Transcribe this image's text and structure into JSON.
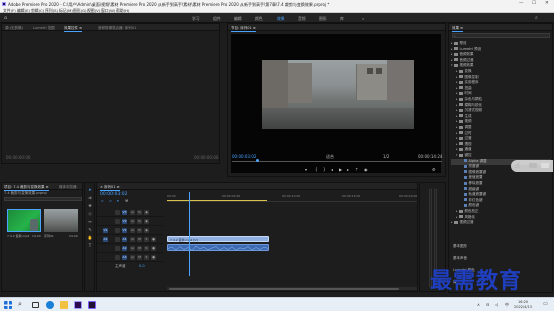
{
  "window": {
    "title": "Adobe Premiere Pro 2020 - C:\\用户\\Admin\\桌面\\视频\\素材 Premiere Pro 2020 从新手到高手\\素材\\素材 Premiere Pro 2020 从新手到高手\\第7章\\7.4 裁剪与变换效果.prproj *",
    "minimize": "—",
    "maximize": "☐",
    "close": "✕"
  },
  "menu": [
    "文件(F)",
    "编辑(E)",
    "剪辑(C)",
    "序列(S)",
    "标记(M)",
    "图形(G)",
    "视图(V)",
    "窗口(W)",
    "帮助(H)"
  ],
  "workspaces": [
    "学习",
    "组件",
    "编辑",
    "颜色",
    "效果",
    "音频",
    "图形",
    "库"
  ],
  "active_workspace": "效果",
  "source_panel": {
    "tabs": [
      "源:(无剪辑)",
      "Lumetri 范围",
      "效果控件 ≡",
      "音频剪辑混合器: 序列01"
    ],
    "active_tab": "效果控件 ≡",
    "timecode_left": "00:00:00:00",
    "timecode_right": "00:00:00:00"
  },
  "program_panel": {
    "title": "节目: 序列01 ≡",
    "timecode": "00:00:03:02",
    "fit": "适合",
    "quality": "1/2",
    "duration": "00:00:14:24"
  },
  "project_panel": {
    "tabs": [
      "项目: 7.4 裁剪与变换效果 ≡",
      "媒体浏览器"
    ],
    "path": "7.4 裁剪与变换效果.prproj",
    "items": [
      {
        "name": "7.4.2 变换.mp4",
        "duration": "14:24"
      },
      {
        "name": "序列01",
        "duration": "14:24"
      }
    ]
  },
  "timeline": {
    "title": "× 序列01 ≡",
    "timecode": "00:00:03:02",
    "ruler": [
      "00:00",
      "00:00:05:00",
      "00:00:10:00",
      "00:00:15:00",
      "00:00:20:00"
    ],
    "video_tracks": [
      "V3",
      "V2",
      "V1"
    ],
    "audio_tracks": [
      "A1",
      "A2",
      "A3"
    ],
    "master": "主声道",
    "master_value": "0.0",
    "clip_label": "7.4.2 变换.mp4 [V]",
    "playhead_fraction": 0.087
  },
  "effects_panel": {
    "title": "效果 ≡",
    "tree": [
      {
        "label": "预设",
        "level": 0,
        "open": false
      },
      {
        "label": "Lumetri 预设",
        "level": 0,
        "open": false
      },
      {
        "label": "音频效果",
        "level": 0,
        "open": false
      },
      {
        "label": "音频过渡",
        "level": 0,
        "open": false
      },
      {
        "label": "视频效果",
        "level": 0,
        "open": true
      },
      {
        "label": "变换",
        "level": 1,
        "open": false
      },
      {
        "label": "图像控制",
        "level": 1,
        "open": false
      },
      {
        "label": "实用程序",
        "level": 1,
        "open": false
      },
      {
        "label": "扭曲",
        "level": 1,
        "open": false
      },
      {
        "label": "时间",
        "level": 1,
        "open": false
      },
      {
        "label": "杂色与颗粒",
        "level": 1,
        "open": false
      },
      {
        "label": "模糊与锐化",
        "level": 1,
        "open": false
      },
      {
        "label": "沉浸式视频",
        "level": 1,
        "open": false
      },
      {
        "label": "生成",
        "level": 1,
        "open": false
      },
      {
        "label": "视频",
        "level": 1,
        "open": false
      },
      {
        "label": "调整",
        "level": 1,
        "open": false
      },
      {
        "label": "过时",
        "level": 1,
        "open": false
      },
      {
        "label": "过渡",
        "level": 1,
        "open": false
      },
      {
        "label": "透视",
        "level": 1,
        "open": false
      },
      {
        "label": "通道",
        "level": 1,
        "open": false
      },
      {
        "label": "键控",
        "level": 1,
        "open": true
      },
      {
        "label": "Alpha 调整",
        "level": 2,
        "open": false,
        "selected": true
      },
      {
        "label": "亮度键",
        "level": 2,
        "open": false
      },
      {
        "label": "图像遮罩键",
        "level": 2,
        "open": false
      },
      {
        "label": "差值遮罩",
        "level": 2,
        "open": false
      },
      {
        "label": "移除遮罩",
        "level": 2,
        "open": false
      },
      {
        "label": "超级键",
        "level": 2,
        "open": false
      },
      {
        "label": "轨道遮罩键",
        "level": 2,
        "open": false
      },
      {
        "label": "非红色键",
        "level": 2,
        "open": false
      },
      {
        "label": "颜色键",
        "level": 2,
        "open": false
      },
      {
        "label": "颜色校正",
        "level": 1,
        "open": false
      },
      {
        "label": "风格化",
        "level": 1,
        "open": false
      },
      {
        "label": "视频过渡",
        "level": 0,
        "open": false
      }
    ],
    "footer": [
      "基本图形",
      "基本声音",
      "Lumetri 颜色",
      "库",
      "标记"
    ]
  },
  "taskbar": {
    "time": "16:20",
    "date": "2022/4/13",
    "ime": "中",
    "apps": [
      "start",
      "search",
      "task-view",
      "edge",
      "explorer",
      "premiere",
      "media-encoder"
    ]
  },
  "watermark": "最需教育",
  "colors": {
    "accent": "#4aa3ff",
    "clip_video": "#8fb0e0",
    "clip_audio": "#3d6bb3",
    "watermark": "#1f3fbf"
  }
}
